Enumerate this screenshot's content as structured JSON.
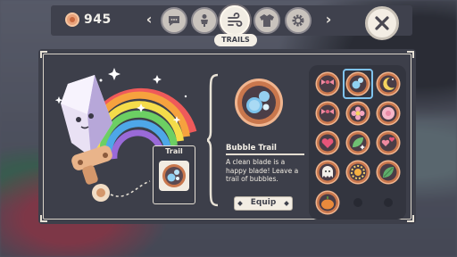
{
  "currency": {
    "icon": "coin-icon",
    "amount": "945"
  },
  "tabs": [
    {
      "name": "chat",
      "icon": "speech-bubble-icon"
    },
    {
      "name": "figure",
      "icon": "figure-icon"
    },
    {
      "name": "trails",
      "icon": "wind-icon",
      "active": true
    },
    {
      "name": "outfit",
      "icon": "shirt-icon"
    },
    {
      "name": "settings",
      "icon": "gear-icon"
    }
  ],
  "active_tab_label": "TRAILS",
  "trail_slot": {
    "title": "Trail"
  },
  "selected_item": {
    "name": "Bubble Trail",
    "description": "A clean blade is a happy blade! Leave a trail of bubbles.",
    "equip_label": "Equip"
  },
  "colors": {
    "panel": "#3d3f4a",
    "cream": "#f3ede3",
    "copper": "#d98a5f",
    "selection": "#7fc3ee"
  },
  "grid_items": [
    "bow-icon",
    "bubbles-icon",
    "moon-icon",
    "bow-icon",
    "flower-icon",
    "blossom-icon",
    "heart-icon",
    "leaf-sparkle-icon",
    "hearts-icon",
    "ghost-icon",
    "sun-icon",
    "leaf-icon",
    "pumpkin-icon",
    "",
    ""
  ]
}
